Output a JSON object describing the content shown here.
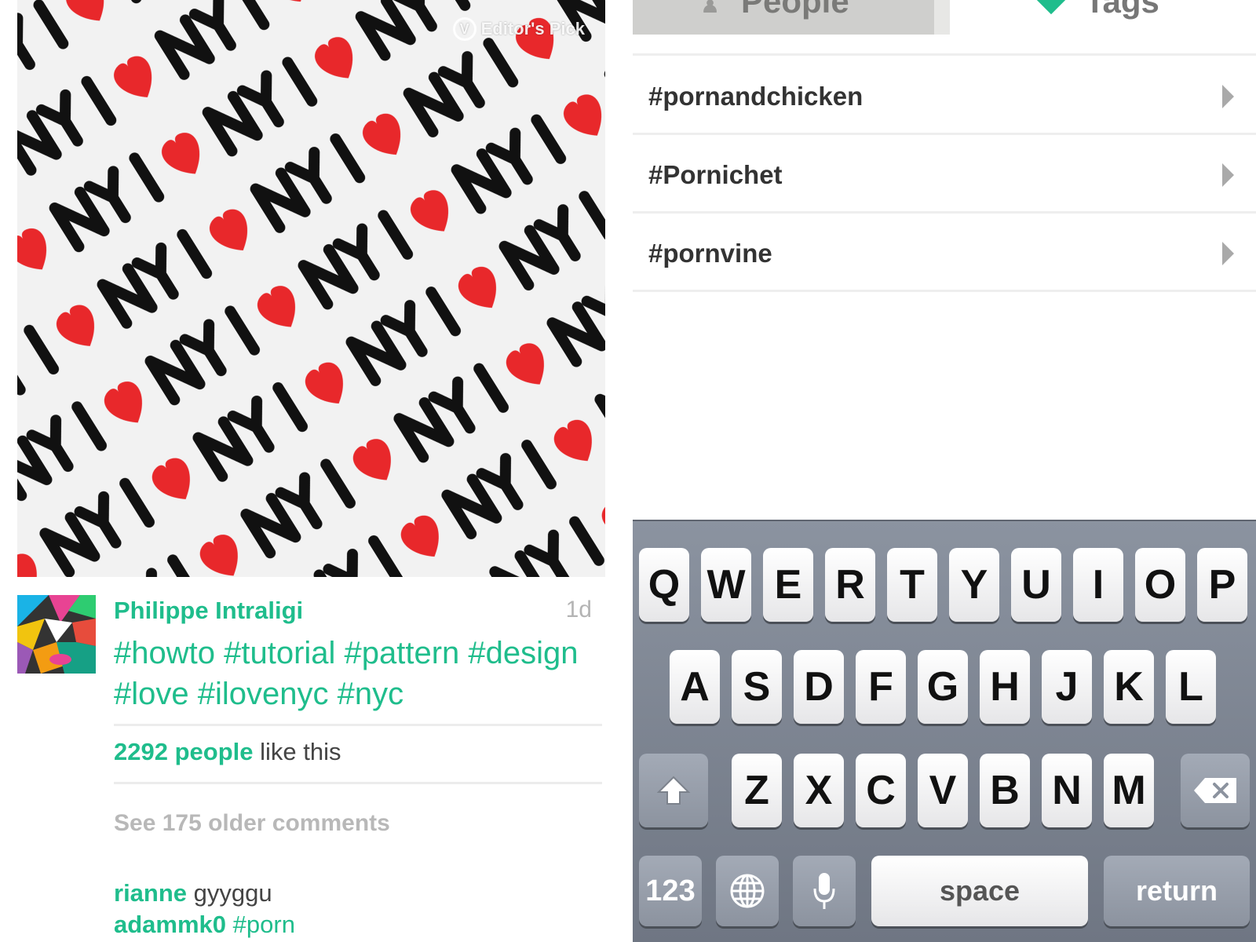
{
  "post": {
    "badge": "Editor's Pick",
    "author": "Philippe Intraligi",
    "time": "1d",
    "caption": "#howto #tutorial #pattern #design #love #ilovenyc #nyc",
    "likes_count": "2292 people",
    "likes_suffix": " like this",
    "older_comments": "See 175 older comments",
    "comments": [
      {
        "user": "rianne",
        "text": "gyyggu"
      },
      {
        "user": "adammk0",
        "text": "#porn"
      }
    ]
  },
  "search": {
    "tabs": [
      {
        "label": "People",
        "icon": "person-icon"
      },
      {
        "label": "Tags",
        "icon": "tag-icon"
      }
    ],
    "results": [
      "#pornandchicken",
      "#Pornichet",
      "#pornvine"
    ]
  },
  "keyboard": {
    "row1": [
      "Q",
      "W",
      "E",
      "R",
      "T",
      "Y",
      "U",
      "I",
      "O",
      "P"
    ],
    "row2": [
      "A",
      "S",
      "D",
      "F",
      "G",
      "H",
      "J",
      "K",
      "L"
    ],
    "row3": [
      "Z",
      "X",
      "C",
      "V",
      "B",
      "N",
      "M"
    ],
    "numbers_label": "123",
    "space_label": "space",
    "return_label": "return"
  },
  "colors": {
    "accent": "#1fbd8c",
    "heart": "#e8282b"
  }
}
